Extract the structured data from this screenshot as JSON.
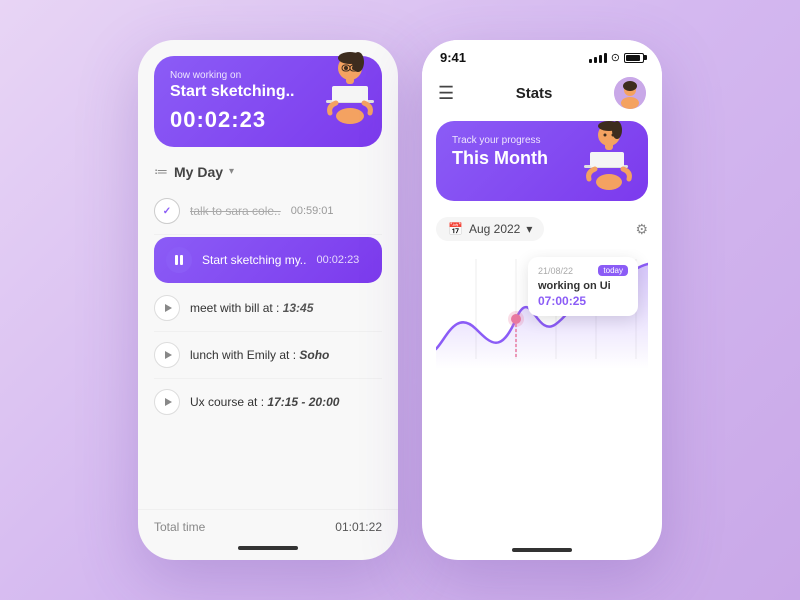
{
  "background": "#d4b8f0",
  "left_phone": {
    "hero": {
      "label": "Now working on",
      "title": "Start sketching..",
      "timer": "00:02:23"
    },
    "my_day": {
      "icon": "≔",
      "title": "My Day",
      "chevron": "∨"
    },
    "tasks": [
      {
        "id": "task-1",
        "name": "talk to sara cole..",
        "time": "00:59:01",
        "state": "checked"
      },
      {
        "id": "task-2",
        "name": "Start sketching my..",
        "time": "00:02:23",
        "state": "active"
      },
      {
        "id": "task-3",
        "name": "meet with bill at :",
        "time_highlight": "13:45",
        "state": "play"
      },
      {
        "id": "task-4",
        "name": "lunch with Emily at :",
        "time_highlight": "Soho",
        "state": "play"
      },
      {
        "id": "task-5",
        "name": "Ux course at :",
        "time_highlight": "17:15 - 20:00",
        "state": "play"
      }
    ],
    "total": {
      "label": "Total time",
      "value": "01:01:22"
    }
  },
  "right_phone": {
    "status_bar": {
      "time": "9:41"
    },
    "nav": {
      "title": "Stats"
    },
    "progress_card": {
      "label": "Track your progress",
      "title": "This Month"
    },
    "date_filter": {
      "label": "Aug 2022",
      "chevron": "∨"
    },
    "tooltip": {
      "date": "21/08/22",
      "badge": "today",
      "task": "working on Ui",
      "time": "07:00:25"
    },
    "chart": {
      "dot_color": "#e879a0",
      "line_color": "#8b5cf6",
      "fill_color_start": "rgba(139,92,246,0.3)",
      "fill_color_end": "rgba(139,92,246,0.0)"
    }
  }
}
